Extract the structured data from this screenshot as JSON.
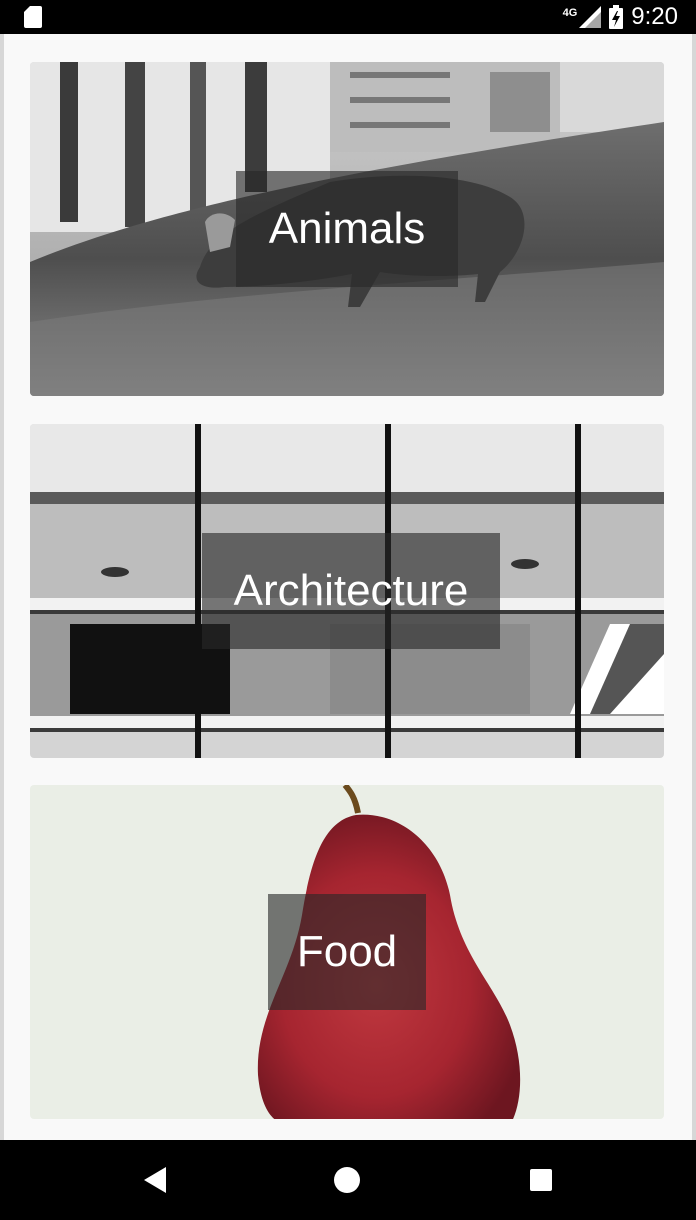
{
  "status_bar": {
    "network": "4G",
    "time": "9:20"
  },
  "categories": [
    {
      "label": "Animals"
    },
    {
      "label": "Architecture"
    },
    {
      "label": "Food"
    }
  ],
  "icons": {
    "sd_card": "sd-card-icon",
    "signal": "signal-icon",
    "battery": "battery-charging-icon",
    "back": "back-icon",
    "home": "home-icon",
    "recents": "recents-icon"
  }
}
